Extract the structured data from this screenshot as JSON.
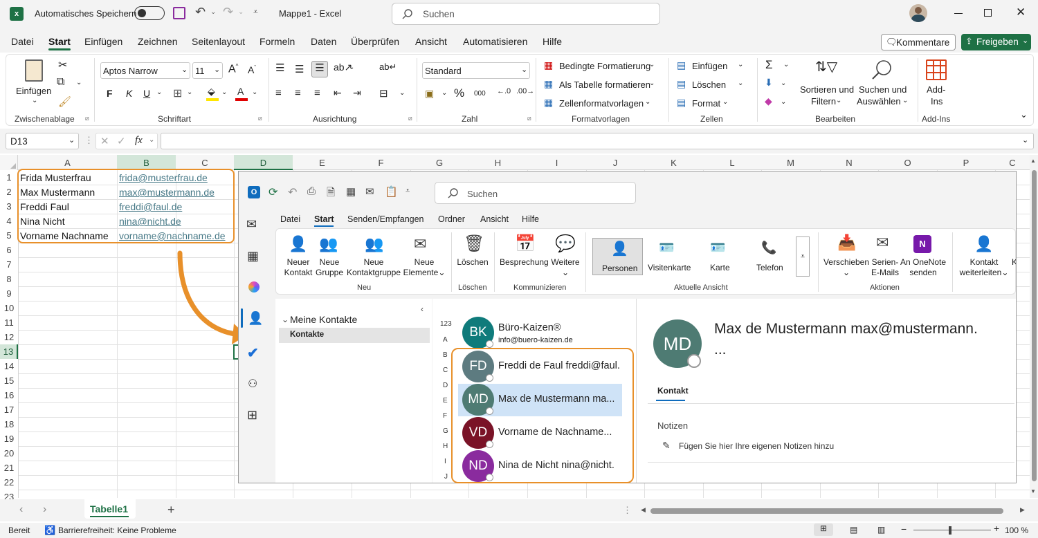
{
  "excel": {
    "autosave_label": "Automatisches Speichern",
    "window_title": "Mappe1  -  Excel",
    "search_placeholder": "Suchen",
    "menu": [
      "Datei",
      "Start",
      "Einfügen",
      "Zeichnen",
      "Seitenlayout",
      "Formeln",
      "Daten",
      "Überprüfen",
      "Ansicht",
      "Automatisieren",
      "Hilfe"
    ],
    "comments_label": "Kommentare",
    "share_label": "Freigeben",
    "ribbon": {
      "paste_label": "Einfügen",
      "font_name": "Aptos Narrow",
      "font_size": "11",
      "bold": "F",
      "italic": "K",
      "underline": "U",
      "number_format": "Standard",
      "cond_format": "Bedingte Formatierung",
      "format_table": "Als Tabelle formatieren",
      "cell_styles": "Zellenformatvorlagen",
      "insert": "Einfügen",
      "delete": "Löschen",
      "format": "Format",
      "sort_filter": "Sortieren und",
      "sort_filter2": "Filtern",
      "find_select": "Suchen und",
      "find_select2": "Auswählen",
      "addins": "Add-",
      "addins2": "Ins",
      "groups": [
        "Zwischenablage",
        "Schriftart",
        "Ausrichtung",
        "Zahl",
        "Formatvorlagen",
        "Zellen",
        "Bearbeiten",
        "Add-Ins"
      ]
    },
    "name_box": "D13",
    "fx": "fx",
    "columns": [
      "A",
      "B",
      "C",
      "D",
      "E",
      "F",
      "G",
      "H",
      "I",
      "J",
      "K",
      "L",
      "M",
      "N",
      "O",
      "P",
      "C"
    ],
    "rows": [
      "1",
      "2",
      "3",
      "4",
      "5",
      "6",
      "7",
      "8",
      "9",
      "10",
      "11",
      "12",
      "13",
      "14",
      "15",
      "16",
      "17",
      "18",
      "19",
      "20",
      "21",
      "22",
      "23"
    ],
    "cells": [
      {
        "name": "Frida Musterfrau",
        "email": "frida@musterfrau.de"
      },
      {
        "name": "Max Mustermann",
        "email": "max@mustermann.de"
      },
      {
        "name": "Freddi Faul",
        "email": "freddi@faul.de"
      },
      {
        "name": "Nina Nicht",
        "email": "nina@nicht.de"
      },
      {
        "name": "Vorname Nachname",
        "email": "vorname@nachname.de"
      }
    ],
    "sheet_tab": "Tabelle1",
    "status_ready": "Bereit",
    "accessibility": "Barrierefreiheit: Keine Probleme",
    "zoom": "100 %",
    "colors": {
      "accent_green": "#1e7145",
      "orange": "#e8902a"
    }
  },
  "outlook": {
    "search_placeholder": "Suchen",
    "tabs": [
      "Datei",
      "Start",
      "Senden/Empfangen",
      "Ordner",
      "Ansicht",
      "Hilfe"
    ],
    "ribbon": {
      "new_contact": [
        "Neuer",
        "Kontakt"
      ],
      "new_group": [
        "Neue",
        "Gruppe"
      ],
      "new_contact_group": [
        "Neue",
        "Kontaktgruppe"
      ],
      "new_items": [
        "Neue",
        "Elemente"
      ],
      "delete": "Löschen",
      "meeting": "Besprechung",
      "more": "Weitere",
      "views": [
        "Personen",
        "Visitenkarte",
        "Karte",
        "Telefon"
      ],
      "move": "Verschieben",
      "mail_merge": [
        "Serien-",
        "E-Mails"
      ],
      "onenote": [
        "An OneNote",
        "senden"
      ],
      "forward_contact": [
        "Kontakt",
        "weiterleiten"
      ],
      "cut_off": "K",
      "groups": [
        "Neu",
        "Löschen",
        "Kommunizieren",
        "Aktuelle Ansicht",
        "Aktionen"
      ]
    },
    "folder_header": "Meine Kontakte",
    "folder_selected": "Kontakte",
    "alpha_index": [
      "123",
      "A",
      "B",
      "C",
      "D",
      "E",
      "F",
      "G",
      "H",
      "I",
      "J"
    ],
    "contacts": [
      {
        "initials": "BK",
        "name": "Büro-Kaizen®",
        "sub": "info@buero-kaizen.de",
        "color": "#0f7b7b"
      },
      {
        "initials": "FD",
        "name": "Freddi de Faul freddi@faul.",
        "color": "#5d7b80"
      },
      {
        "initials": "MD",
        "name": "Max de Mustermann ma...",
        "color": "#4e7b73"
      },
      {
        "initials": "VD",
        "name": "Vorname de Nachname...",
        "color": "#7a1327"
      },
      {
        "initials": "ND",
        "name": "Nina de Nicht nina@nicht.",
        "color": "#8a2b9e"
      }
    ],
    "detail": {
      "initials": "MD",
      "title": "Max de Mustermann max@mustermann.",
      "title2": "...",
      "tab": "Kontakt",
      "notes_label": "Notizen",
      "notes_placeholder": "Fügen Sie hier Ihre eigenen Notizen hinzu"
    }
  }
}
